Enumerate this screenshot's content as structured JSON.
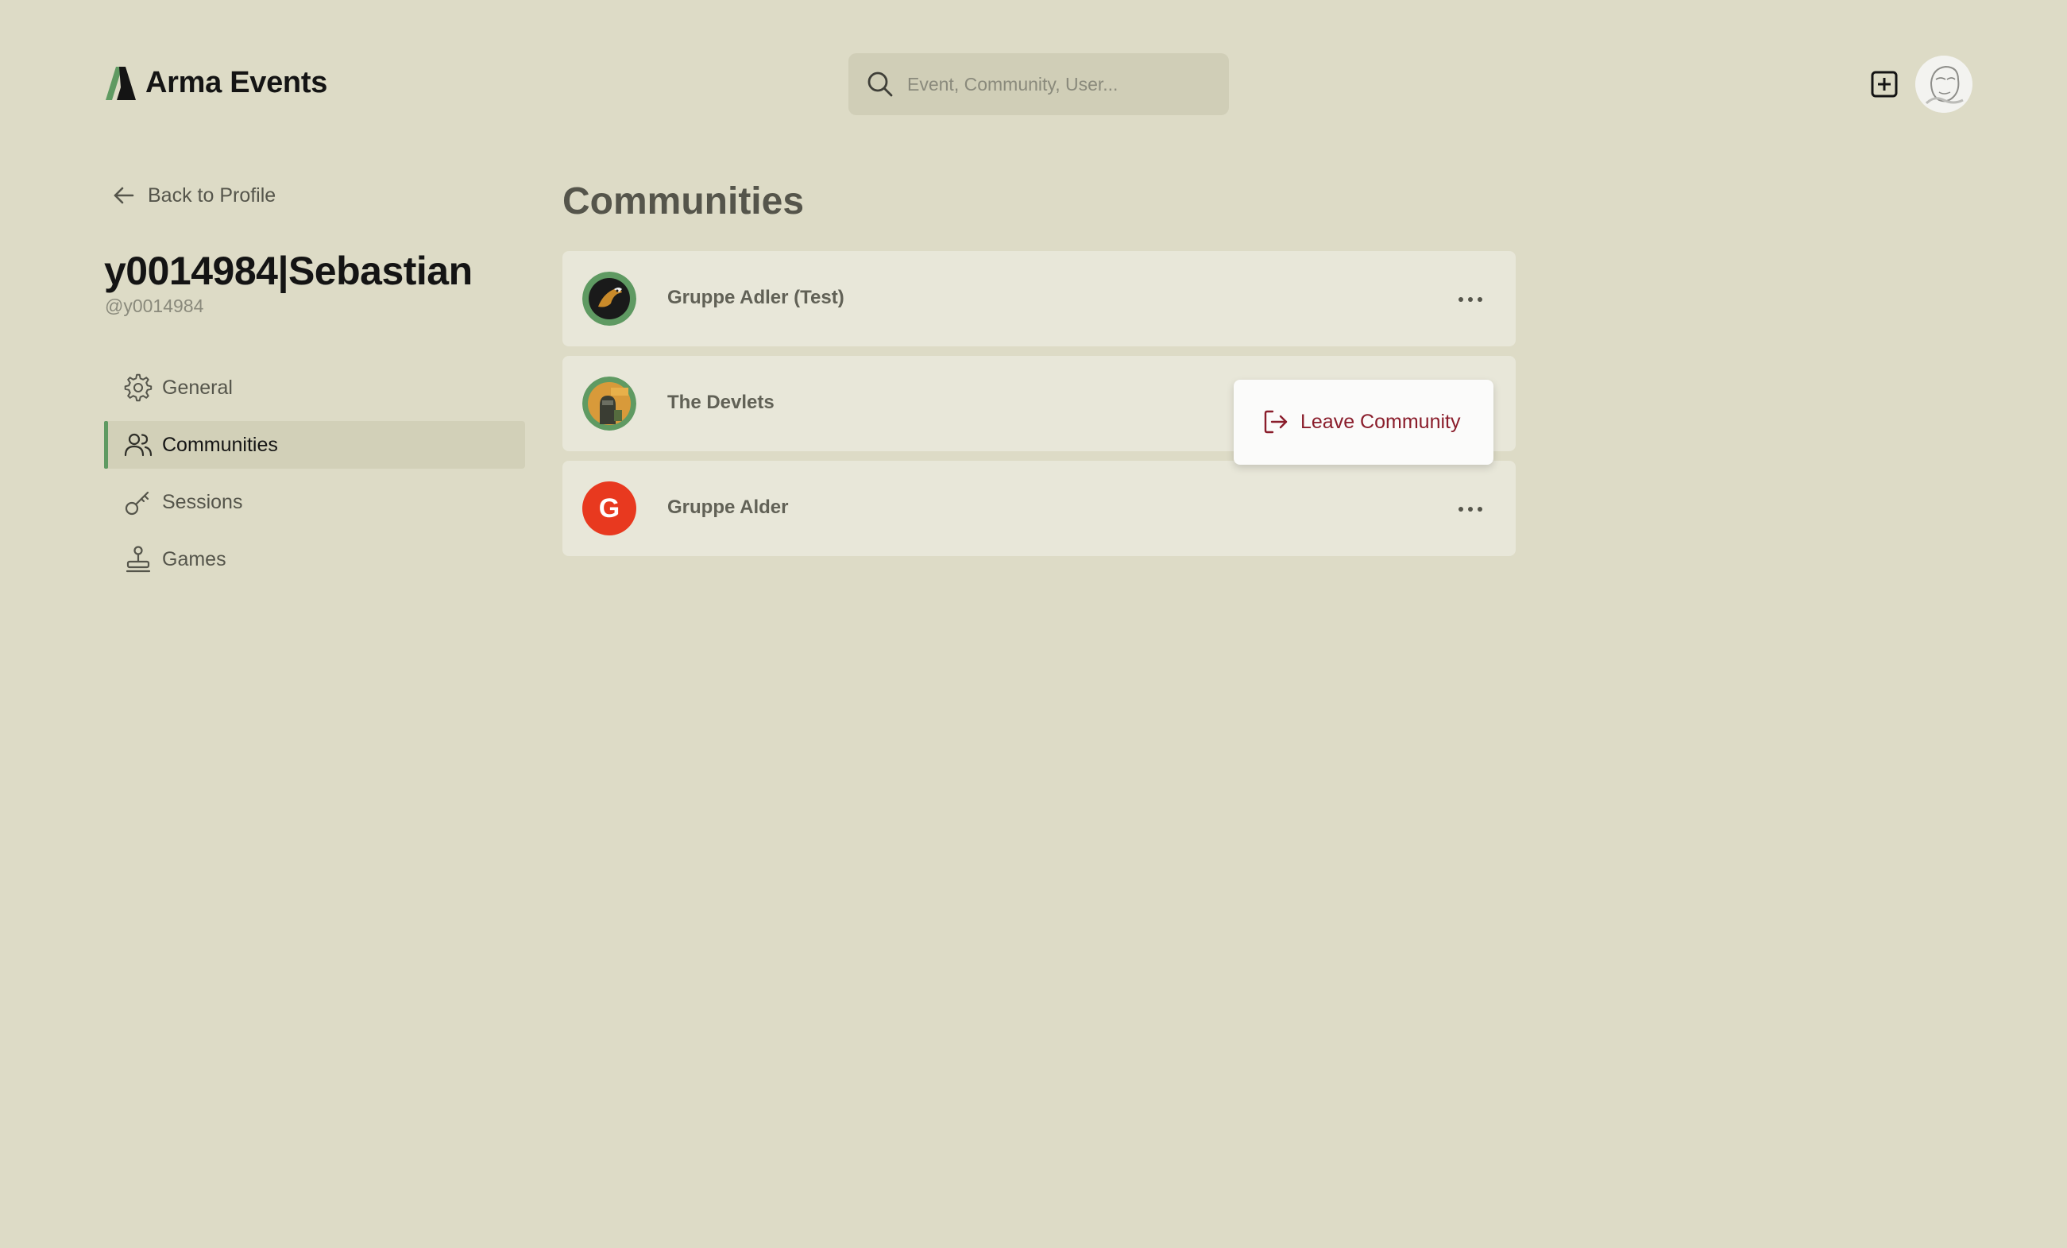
{
  "header": {
    "brand_name": "Arma Events",
    "search_placeholder": "Event, Community, User..."
  },
  "sidebar": {
    "back_label": "Back to Profile",
    "user_display_name": "y0014984|Sebastian",
    "user_handle": "@y0014984",
    "items": [
      {
        "label": "General",
        "icon": "gear-icon",
        "active": false
      },
      {
        "label": "Communities",
        "icon": "users-icon",
        "active": true
      },
      {
        "label": "Sessions",
        "icon": "key-icon",
        "active": false
      },
      {
        "label": "Games",
        "icon": "joystick-icon",
        "active": false
      }
    ]
  },
  "main": {
    "title": "Communities",
    "communities": [
      {
        "name": "Gruppe Adler (Test)",
        "avatar": "eagle-logo"
      },
      {
        "name": "The Devlets",
        "avatar": "devlets-logo"
      },
      {
        "name": "Gruppe Alder",
        "avatar_letter": "G"
      }
    ],
    "menu": {
      "label": "Leave Community",
      "icon": "logout-icon"
    }
  },
  "colors": {
    "background": "#dddbc6",
    "accent_green": "#5f9a62",
    "danger_text": "#8a1d2b",
    "letter_avatar": "#e8391f"
  }
}
